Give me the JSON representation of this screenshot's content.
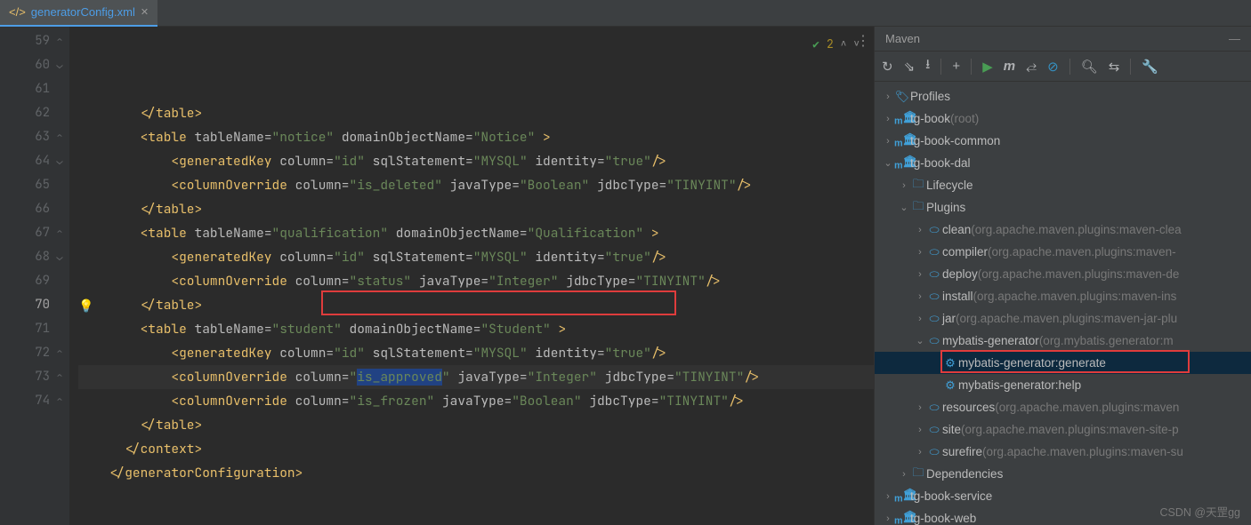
{
  "tab": {
    "filename": "generatorConfig.xml"
  },
  "vcs": {
    "check": "✔",
    "count": "2"
  },
  "gutter": {
    "start": 59,
    "end": 74,
    "highlight": 70
  },
  "code": {
    "lines": [
      {
        "indent": 8,
        "t": "</table>"
      },
      {
        "indent": 8,
        "open": "table",
        "attrs": [
          [
            "tableName",
            "notice"
          ],
          [
            "domainObjectName",
            "Notice"
          ]
        ],
        "tailspace": true
      },
      {
        "indent": 12,
        "open": "generatedKey",
        "attrs": [
          [
            "column",
            "id"
          ],
          [
            "sqlStatement",
            "MYSQL"
          ],
          [
            "identity",
            "true"
          ]
        ],
        "self": true
      },
      {
        "indent": 12,
        "open": "columnOverride",
        "attrs": [
          [
            "column",
            "is_deleted"
          ],
          [
            "javaType",
            "Boolean"
          ],
          [
            "jdbcType",
            "TINYINT"
          ]
        ],
        "self": true
      },
      {
        "indent": 8,
        "t": "</table>"
      },
      {
        "indent": 8,
        "open": "table",
        "attrs": [
          [
            "tableName",
            "qualification"
          ],
          [
            "domainObjectName",
            "Qualification"
          ]
        ],
        "tailspace": true
      },
      {
        "indent": 12,
        "open": "generatedKey",
        "attrs": [
          [
            "column",
            "id"
          ],
          [
            "sqlStatement",
            "MYSQL"
          ],
          [
            "identity",
            "true"
          ]
        ],
        "self": true
      },
      {
        "indent": 12,
        "open": "columnOverride",
        "attrs": [
          [
            "column",
            "status"
          ],
          [
            "javaType",
            "Integer"
          ],
          [
            "jdbcType",
            "TINYINT"
          ]
        ],
        "self": true
      },
      {
        "indent": 8,
        "t": "</table>"
      },
      {
        "indent": 8,
        "open": "table",
        "attrs": [
          [
            "tableName",
            "student"
          ],
          [
            "domainObjectName",
            "Student"
          ]
        ],
        "tailspace": true
      },
      {
        "indent": 12,
        "open": "generatedKey",
        "attrs": [
          [
            "column",
            "id"
          ],
          [
            "sqlStatement",
            "MYSQL"
          ],
          [
            "identity",
            "true"
          ]
        ],
        "self": true
      },
      {
        "indent": 12,
        "open": "columnOverride",
        "attrs": [
          [
            "column",
            "is_approved"
          ],
          [
            "javaType",
            "Integer"
          ],
          [
            "jdbcType",
            "TINYINT"
          ]
        ],
        "self": true,
        "hl": true,
        "sel_attr_val": "is_approved"
      },
      {
        "indent": 12,
        "open": "columnOverride",
        "attrs": [
          [
            "column",
            "is_frozen"
          ],
          [
            "javaType",
            "Boolean"
          ],
          [
            "jdbcType",
            "TINYINT"
          ]
        ],
        "self": true
      },
      {
        "indent": 8,
        "t": "</table>"
      },
      {
        "indent": 6,
        "t": "</context>"
      },
      {
        "indent": 4,
        "t": "</generatorConfiguration>"
      }
    ]
  },
  "maven": {
    "title": "Maven",
    "toolbar": [
      "↻",
      "⇘",
      "⭳",
      "+",
      "▶",
      "m",
      "⇄",
      "⊙",
      "🔍",
      "⇆",
      "🔧"
    ],
    "tree": [
      {
        "d": 0,
        "exp": ">",
        "icon": "🏷",
        "label": "Profiles"
      },
      {
        "d": 0,
        "exp": ">",
        "icon": "m",
        "label": "tg-book",
        "dim": "(root)"
      },
      {
        "d": 0,
        "exp": ">",
        "icon": "m",
        "label": "tg-book-common"
      },
      {
        "d": 0,
        "exp": "v",
        "icon": "m",
        "label": "tg-book-dal"
      },
      {
        "d": 1,
        "exp": ">",
        "icon": "📁",
        "label": "Lifecycle"
      },
      {
        "d": 1,
        "exp": "v",
        "icon": "📁",
        "label": "Plugins"
      },
      {
        "d": 2,
        "exp": ">",
        "icon": "⚙",
        "label": "clean",
        "dim": "(org.apache.maven.plugins:maven-clea"
      },
      {
        "d": 2,
        "exp": ">",
        "icon": "⚙",
        "label": "compiler",
        "dim": "(org.apache.maven.plugins:maven-"
      },
      {
        "d": 2,
        "exp": ">",
        "icon": "⚙",
        "label": "deploy",
        "dim": "(org.apache.maven.plugins:maven-de"
      },
      {
        "d": 2,
        "exp": ">",
        "icon": "⚙",
        "label": "install",
        "dim": "(org.apache.maven.plugins:maven-ins"
      },
      {
        "d": 2,
        "exp": ">",
        "icon": "⚙",
        "label": "jar",
        "dim": "(org.apache.maven.plugins:maven-jar-plu"
      },
      {
        "d": 2,
        "exp": "v",
        "icon": "⚙",
        "label": "mybatis-generator",
        "dim": "(org.mybatis.generator:m"
      },
      {
        "d": 3,
        "exp": "",
        "icon": "⚙g",
        "label": "mybatis-generator:generate",
        "selected": true,
        "boxed": true
      },
      {
        "d": 3,
        "exp": "",
        "icon": "⚙g",
        "label": "mybatis-generator:help"
      },
      {
        "d": 2,
        "exp": ">",
        "icon": "⚙",
        "label": "resources",
        "dim": "(org.apache.maven.plugins:maven"
      },
      {
        "d": 2,
        "exp": ">",
        "icon": "⚙",
        "label": "site",
        "dim": "(org.apache.maven.plugins:maven-site-p"
      },
      {
        "d": 2,
        "exp": ">",
        "icon": "⚙",
        "label": "surefire",
        "dim": "(org.apache.maven.plugins:maven-su"
      },
      {
        "d": 1,
        "exp": ">",
        "icon": "📁",
        "label": "Dependencies"
      },
      {
        "d": 0,
        "exp": ">",
        "icon": "m",
        "label": "tg-book-service"
      },
      {
        "d": 0,
        "exp": ">",
        "icon": "m",
        "label": "tg-book-web"
      }
    ]
  },
  "watermark": "CSDN @天罡gg"
}
